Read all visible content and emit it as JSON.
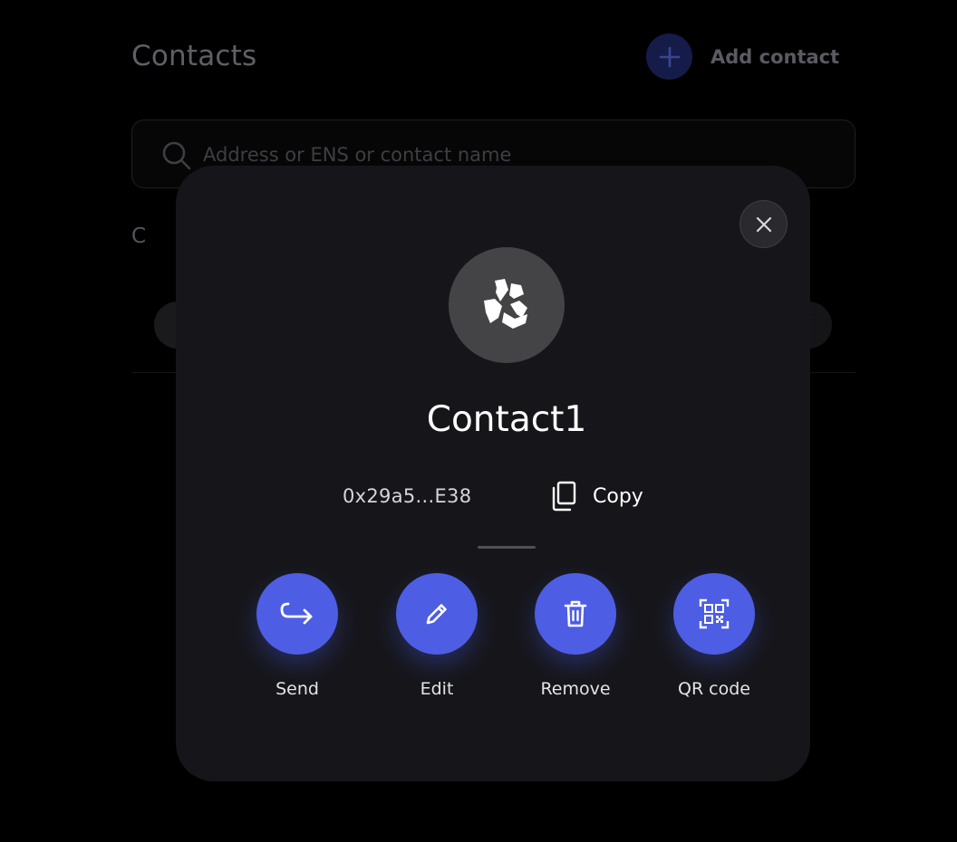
{
  "background": {
    "title": "Contacts",
    "add_contact_label": "Add contact",
    "search_placeholder": "Address or ENS or contact name",
    "group_letter": "C"
  },
  "modal": {
    "contact_name": "Contact1",
    "address": "0x29a5...E38",
    "copy_label": "Copy",
    "actions": [
      {
        "label": "Send",
        "icon": "send-arrow-icon"
      },
      {
        "label": "Edit",
        "icon": "pencil-icon"
      },
      {
        "label": "Remove",
        "icon": "trash-icon"
      },
      {
        "label": "QR code",
        "icon": "qr-code-icon"
      }
    ]
  },
  "colors": {
    "accent": "#4d5ee4",
    "modal_bg": "#16161a",
    "avatar_bg": "#444447"
  }
}
